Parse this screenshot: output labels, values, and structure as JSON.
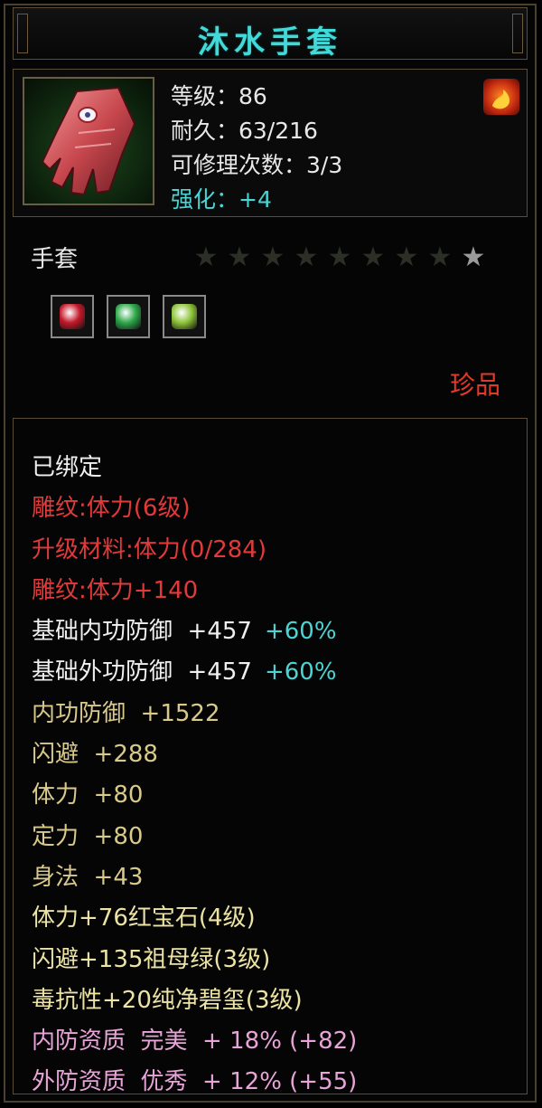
{
  "item": {
    "name": "沐水手套",
    "level_line": "等级：86",
    "durability_line": "耐久：63/216",
    "repair_line": "可修理次数：3/3",
    "enhance_line": "强化：+4",
    "type": "手套",
    "rarity": "珍品",
    "stars_total": 9,
    "stars_lit": 1,
    "icon": "glove-icon",
    "emblem_icon": "flame-emblem-icon"
  },
  "gems": [
    {
      "name": "ruby-gem-icon",
      "color": "#c41a2a"
    },
    {
      "name": "emerald-gem-icon",
      "color": "#2ea84a"
    },
    {
      "name": "jade-gem-icon",
      "color": "#8ec43a"
    }
  ],
  "stats": [
    {
      "text": "已绑定",
      "color": "w"
    },
    {
      "text": "雕纹:体力(6级)",
      "color": "r"
    },
    {
      "text": "升级材料:体力(0/284)",
      "color": "r"
    },
    {
      "text": "雕纹:体力+140",
      "color": "r"
    },
    {
      "text": "基础内功防御  +457",
      "extra": "+60%",
      "color": "w"
    },
    {
      "text": "基础外功防御  +457",
      "extra": "+60%",
      "color": "w"
    },
    {
      "text": "内功防御  +1522",
      "color": "g"
    },
    {
      "text": "闪避  +288",
      "color": "g"
    },
    {
      "text": "体力  +80",
      "color": "g"
    },
    {
      "text": "定力  +80",
      "color": "g"
    },
    {
      "text": "身法  +43",
      "color": "g"
    },
    {
      "text": "体力+76红宝石(4级)",
      "color": "y"
    },
    {
      "text": "闪避+135祖母绿(3级)",
      "color": "y"
    },
    {
      "text": "毒抗性+20纯净碧玺(3级)",
      "color": "y"
    },
    {
      "text": "内防资质  完美  + 18% (+82)",
      "color": "p"
    },
    {
      "text": "外防资质  优秀  + 12% (+55)",
      "color": "p"
    }
  ],
  "colors": {
    "title": "#42d9d9",
    "rarity": "#e03a2a",
    "accent": "#4ad4d4"
  }
}
